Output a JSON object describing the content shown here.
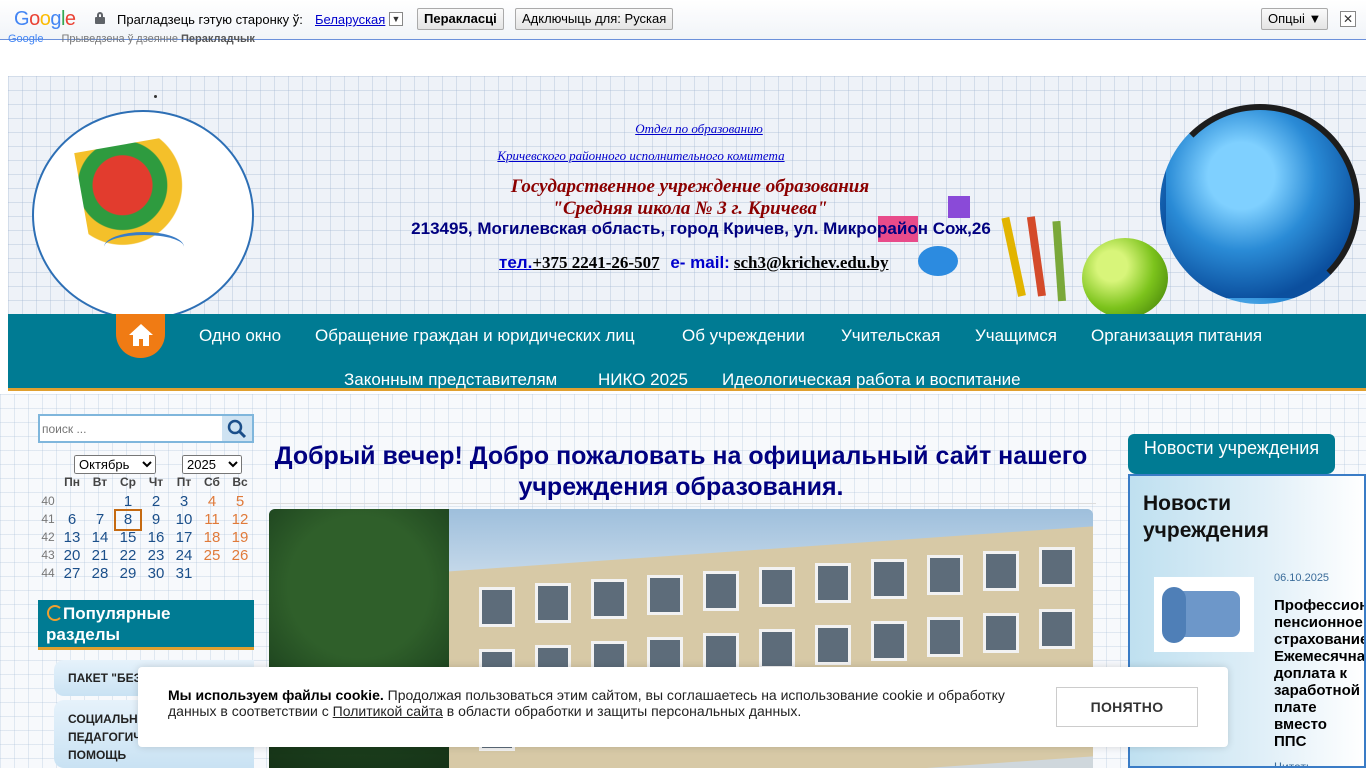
{
  "translate_bar": {
    "logo": "Google",
    "prompt": "Прагладзець гэтую старонку ў:",
    "language": "Беларуская",
    "translate_button": "Перакласці",
    "disable_button": "Адключыць для: Руская",
    "options_button": "Опцыі ▼",
    "close_label": "✕",
    "sub_logo": "Google",
    "sub_text": "Прыведзена ў дзеянне",
    "sub_brand": "Перакладчык",
    "icons": [
      "lock-icon",
      "dropdown-arrow-icon",
      "close-icon"
    ]
  },
  "header": {
    "link1": "Отдел по образованию",
    "link2": "Кричевского районного исполнительного комитета",
    "title1": "Государственное учреждение образования",
    "title2": "\"Средняя школа № 3 г. Кричева\"",
    "address": "213495, Могилевская область, город Кричев, ул. Микрорайон Сож,26",
    "tel_label": "тел.",
    "phone": "+375 2241-26-507",
    "email_label": "е- mail:",
    "email": "sch3@krichev.edu.by"
  },
  "nav": {
    "home_icon": "home-icon",
    "items_row1": [
      "Одно окно",
      "Обращение граждан и юридических лиц",
      "Об учреждении",
      "Учительская",
      "Учащимся",
      "Организация питания"
    ],
    "items_row2": [
      "Законным представителям",
      "НИКО 2025",
      "Идеологическая работа и воспитание"
    ],
    "colors": {
      "bar": "#007b93",
      "home": "#f07b14",
      "accent": "#e0a030"
    }
  },
  "search": {
    "placeholder": "поиск ...",
    "icon": "search-icon"
  },
  "calendar": {
    "month": "Октябрь",
    "year": "2025",
    "weekdays": [
      "Пн",
      "Вт",
      "Ср",
      "Чт",
      "Пт",
      "Сб",
      "Вс"
    ],
    "weeks": [
      {
        "num": "40",
        "days": [
          "",
          "",
          "1",
          "2",
          "3",
          "4",
          "5"
        ]
      },
      {
        "num": "41",
        "days": [
          "6",
          "7",
          "8",
          "9",
          "10",
          "11",
          "12"
        ]
      },
      {
        "num": "42",
        "days": [
          "13",
          "14",
          "15",
          "16",
          "17",
          "18",
          "19"
        ]
      },
      {
        "num": "43",
        "days": [
          "20",
          "21",
          "22",
          "23",
          "24",
          "25",
          "26"
        ]
      },
      {
        "num": "44",
        "days": [
          "27",
          "28",
          "29",
          "30",
          "31",
          "",
          ""
        ]
      }
    ],
    "today": "8"
  },
  "popular": {
    "title": "Популярные разделы",
    "items": [
      "ПАКЕТ \"БЕЗ",
      "СОЦИАЛЬНО-ПЕДАГОГИЧЕСКАЯ ПОМОЩЬ"
    ]
  },
  "main": {
    "welcome": "Добрый вечер! Добро пожаловать на официальный сайт нашего учреждения образования."
  },
  "news": {
    "tab": "Новости учреждения",
    "title": "Новости учреждения",
    "date": "06.10.2025",
    "headline": "Профессиональное\nпенсионное\nстрахование.\nЕжемесячная\nдоплата к\nзаработной\nплате\nвместо\nППС",
    "more": "Читать"
  },
  "cookie": {
    "bold": "Мы используем файлы cookie.",
    "text1": " Продолжая пользоваться этим сайтом, вы соглашаетесь на использование cookie и обработку данных в соответствии с ",
    "link": "Политикой сайта",
    "text2": " в области обработки и защиты персональных данных.",
    "button": "ПОНЯТНО"
  }
}
